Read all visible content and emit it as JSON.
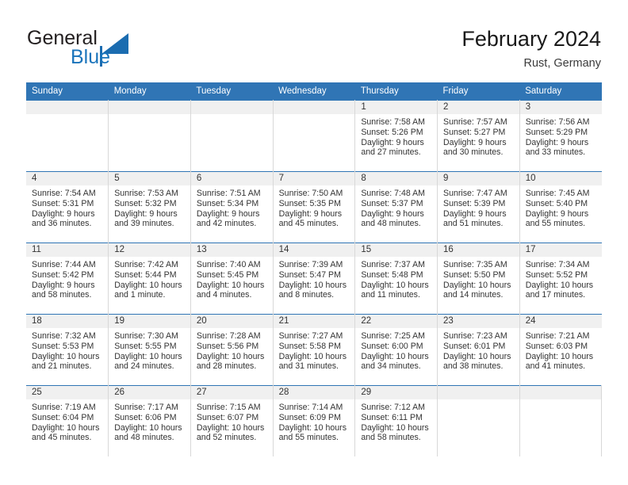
{
  "brand": {
    "name_part1": "General",
    "name_part2": "Blue",
    "logo_icon": "triangle-flag-icon"
  },
  "header": {
    "title": "February 2024",
    "subtitle": "Rust, Germany"
  },
  "colors": {
    "header_blue": "#3075b5",
    "brand_blue": "#1a74bb",
    "daynum_band": "#f0f0f0",
    "cell_border": "#d8d8d8",
    "text": "#333333"
  },
  "weekday_headers": [
    "Sunday",
    "Monday",
    "Tuesday",
    "Wednesday",
    "Thursday",
    "Friday",
    "Saturday"
  ],
  "labels": {
    "sunrise_prefix": "Sunrise:",
    "sunset_prefix": "Sunset:",
    "daylight_prefix": "Daylight:"
  },
  "weeks": [
    [
      {
        "day": "",
        "blank": true
      },
      {
        "day": "",
        "blank": true
      },
      {
        "day": "",
        "blank": true
      },
      {
        "day": "",
        "blank": true
      },
      {
        "day": "1",
        "sunrise": "Sunrise: 7:58 AM",
        "sunset": "Sunset: 5:26 PM",
        "daylight1": "Daylight: 9 hours",
        "daylight2": "and 27 minutes."
      },
      {
        "day": "2",
        "sunrise": "Sunrise: 7:57 AM",
        "sunset": "Sunset: 5:27 PM",
        "daylight1": "Daylight: 9 hours",
        "daylight2": "and 30 minutes."
      },
      {
        "day": "3",
        "sunrise": "Sunrise: 7:56 AM",
        "sunset": "Sunset: 5:29 PM",
        "daylight1": "Daylight: 9 hours",
        "daylight2": "and 33 minutes."
      }
    ],
    [
      {
        "day": "4",
        "sunrise": "Sunrise: 7:54 AM",
        "sunset": "Sunset: 5:31 PM",
        "daylight1": "Daylight: 9 hours",
        "daylight2": "and 36 minutes."
      },
      {
        "day": "5",
        "sunrise": "Sunrise: 7:53 AM",
        "sunset": "Sunset: 5:32 PM",
        "daylight1": "Daylight: 9 hours",
        "daylight2": "and 39 minutes."
      },
      {
        "day": "6",
        "sunrise": "Sunrise: 7:51 AM",
        "sunset": "Sunset: 5:34 PM",
        "daylight1": "Daylight: 9 hours",
        "daylight2": "and 42 minutes."
      },
      {
        "day": "7",
        "sunrise": "Sunrise: 7:50 AM",
        "sunset": "Sunset: 5:35 PM",
        "daylight1": "Daylight: 9 hours",
        "daylight2": "and 45 minutes."
      },
      {
        "day": "8",
        "sunrise": "Sunrise: 7:48 AM",
        "sunset": "Sunset: 5:37 PM",
        "daylight1": "Daylight: 9 hours",
        "daylight2": "and 48 minutes."
      },
      {
        "day": "9",
        "sunrise": "Sunrise: 7:47 AM",
        "sunset": "Sunset: 5:39 PM",
        "daylight1": "Daylight: 9 hours",
        "daylight2": "and 51 minutes."
      },
      {
        "day": "10",
        "sunrise": "Sunrise: 7:45 AM",
        "sunset": "Sunset: 5:40 PM",
        "daylight1": "Daylight: 9 hours",
        "daylight2": "and 55 minutes."
      }
    ],
    [
      {
        "day": "11",
        "sunrise": "Sunrise: 7:44 AM",
        "sunset": "Sunset: 5:42 PM",
        "daylight1": "Daylight: 9 hours",
        "daylight2": "and 58 minutes."
      },
      {
        "day": "12",
        "sunrise": "Sunrise: 7:42 AM",
        "sunset": "Sunset: 5:44 PM",
        "daylight1": "Daylight: 10 hours",
        "daylight2": "and 1 minute."
      },
      {
        "day": "13",
        "sunrise": "Sunrise: 7:40 AM",
        "sunset": "Sunset: 5:45 PM",
        "daylight1": "Daylight: 10 hours",
        "daylight2": "and 4 minutes."
      },
      {
        "day": "14",
        "sunrise": "Sunrise: 7:39 AM",
        "sunset": "Sunset: 5:47 PM",
        "daylight1": "Daylight: 10 hours",
        "daylight2": "and 8 minutes."
      },
      {
        "day": "15",
        "sunrise": "Sunrise: 7:37 AM",
        "sunset": "Sunset: 5:48 PM",
        "daylight1": "Daylight: 10 hours",
        "daylight2": "and 11 minutes."
      },
      {
        "day": "16",
        "sunrise": "Sunrise: 7:35 AM",
        "sunset": "Sunset: 5:50 PM",
        "daylight1": "Daylight: 10 hours",
        "daylight2": "and 14 minutes."
      },
      {
        "day": "17",
        "sunrise": "Sunrise: 7:34 AM",
        "sunset": "Sunset: 5:52 PM",
        "daylight1": "Daylight: 10 hours",
        "daylight2": "and 17 minutes."
      }
    ],
    [
      {
        "day": "18",
        "sunrise": "Sunrise: 7:32 AM",
        "sunset": "Sunset: 5:53 PM",
        "daylight1": "Daylight: 10 hours",
        "daylight2": "and 21 minutes."
      },
      {
        "day": "19",
        "sunrise": "Sunrise: 7:30 AM",
        "sunset": "Sunset: 5:55 PM",
        "daylight1": "Daylight: 10 hours",
        "daylight2": "and 24 minutes."
      },
      {
        "day": "20",
        "sunrise": "Sunrise: 7:28 AM",
        "sunset": "Sunset: 5:56 PM",
        "daylight1": "Daylight: 10 hours",
        "daylight2": "and 28 minutes."
      },
      {
        "day": "21",
        "sunrise": "Sunrise: 7:27 AM",
        "sunset": "Sunset: 5:58 PM",
        "daylight1": "Daylight: 10 hours",
        "daylight2": "and 31 minutes."
      },
      {
        "day": "22",
        "sunrise": "Sunrise: 7:25 AM",
        "sunset": "Sunset: 6:00 PM",
        "daylight1": "Daylight: 10 hours",
        "daylight2": "and 34 minutes."
      },
      {
        "day": "23",
        "sunrise": "Sunrise: 7:23 AM",
        "sunset": "Sunset: 6:01 PM",
        "daylight1": "Daylight: 10 hours",
        "daylight2": "and 38 minutes."
      },
      {
        "day": "24",
        "sunrise": "Sunrise: 7:21 AM",
        "sunset": "Sunset: 6:03 PM",
        "daylight1": "Daylight: 10 hours",
        "daylight2": "and 41 minutes."
      }
    ],
    [
      {
        "day": "25",
        "sunrise": "Sunrise: 7:19 AM",
        "sunset": "Sunset: 6:04 PM",
        "daylight1": "Daylight: 10 hours",
        "daylight2": "and 45 minutes."
      },
      {
        "day": "26",
        "sunrise": "Sunrise: 7:17 AM",
        "sunset": "Sunset: 6:06 PM",
        "daylight1": "Daylight: 10 hours",
        "daylight2": "and 48 minutes."
      },
      {
        "day": "27",
        "sunrise": "Sunrise: 7:15 AM",
        "sunset": "Sunset: 6:07 PM",
        "daylight1": "Daylight: 10 hours",
        "daylight2": "and 52 minutes."
      },
      {
        "day": "28",
        "sunrise": "Sunrise: 7:14 AM",
        "sunset": "Sunset: 6:09 PM",
        "daylight1": "Daylight: 10 hours",
        "daylight2": "and 55 minutes."
      },
      {
        "day": "29",
        "sunrise": "Sunrise: 7:12 AM",
        "sunset": "Sunset: 6:11 PM",
        "daylight1": "Daylight: 10 hours",
        "daylight2": "and 58 minutes."
      },
      {
        "day": "",
        "blank": true
      },
      {
        "day": "",
        "blank": true
      }
    ]
  ]
}
